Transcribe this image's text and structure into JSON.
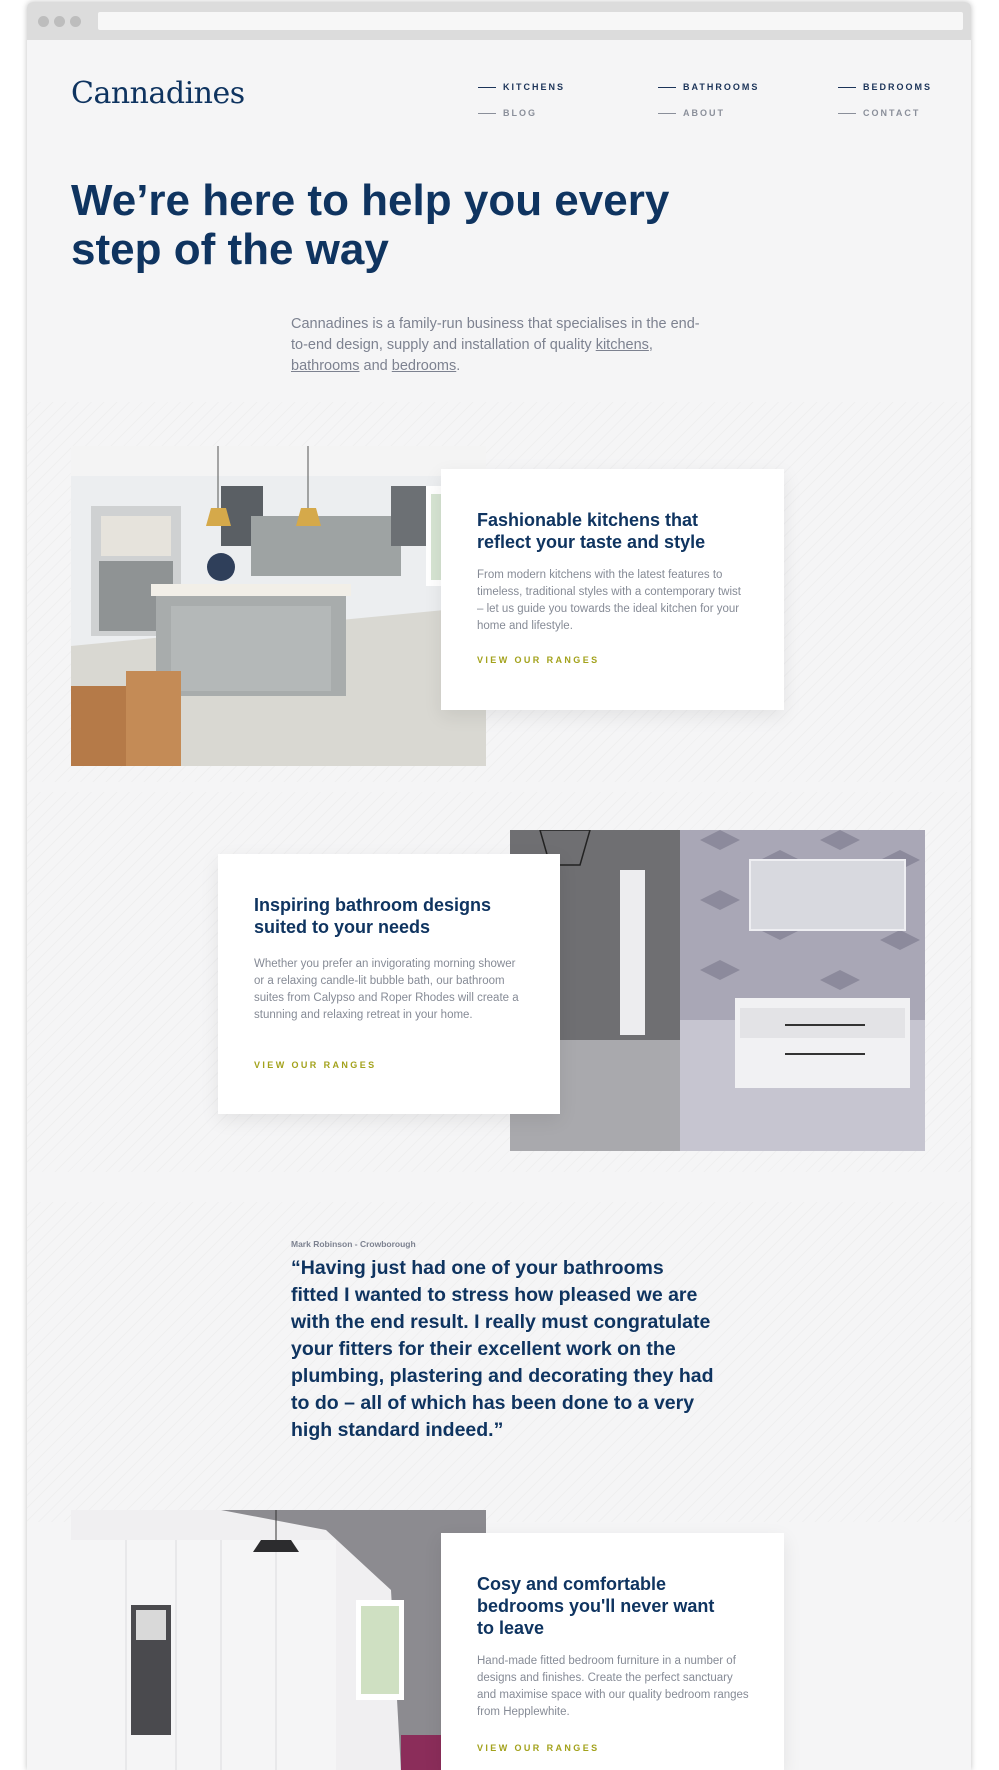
{
  "site": {
    "logo": "Cannadines",
    "nav_primary": [
      "KITCHENS",
      "BATHROOMS",
      "BEDROOMS"
    ],
    "nav_secondary": [
      "BLOG",
      "ABOUT",
      "CONTACT"
    ]
  },
  "hero": {
    "title": "We’re here to help you every step of the way",
    "intro_before": "Cannadines is a family-run business that specialises in the end-to-end design, supply and installation of quality ",
    "link_kitchens": "kitchens",
    "comma": ",",
    "link_bathrooms": "bathrooms",
    "and": " and ",
    "link_bedrooms": "bedrooms",
    "period": "."
  },
  "sections": {
    "kitchens": {
      "title": "Fashionable kitchens that reflect your taste and style",
      "text": "From modern kitchens with the latest features to timeless, traditional styles with a contemporary twist – let us guide you towards the ideal kitchen for your home and lifestyle.",
      "link": "VIEW OUR RANGES"
    },
    "bathrooms": {
      "title": "Inspiring bathroom designs suited to your needs",
      "text": "Whether you prefer an invigorating morning shower or a relaxing candle-lit bubble bath, our bathroom suites from Calypso and Roper Rhodes will create a stunning and relaxing retreat in your home.",
      "link": "VIEW OUR RANGES"
    },
    "bedrooms": {
      "title": "Cosy and comfortable bedrooms you'll never want to leave",
      "text": "Hand-made fitted bedroom furniture in a number of designs and finishes. Create the perfect sanctuary and maximise space with our quality bedroom ranges from Hepplewhite.",
      "link": "VIEW OUR RANGES"
    }
  },
  "testimonial": {
    "author": "Mark Robinson - Crowborough",
    "quote": "“Having just had one of your bathrooms fitted I wanted to stress how pleased we are with the end result. I really must congratulate your fitters for their excellent work on the plumbing, plastering and decorating they had to do – all of which has been done to a very high standard indeed.”"
  },
  "colors": {
    "brand_navy": "#0f3460",
    "accent_olive": "#a3a21c",
    "page_bg": "#f5f5f6"
  }
}
